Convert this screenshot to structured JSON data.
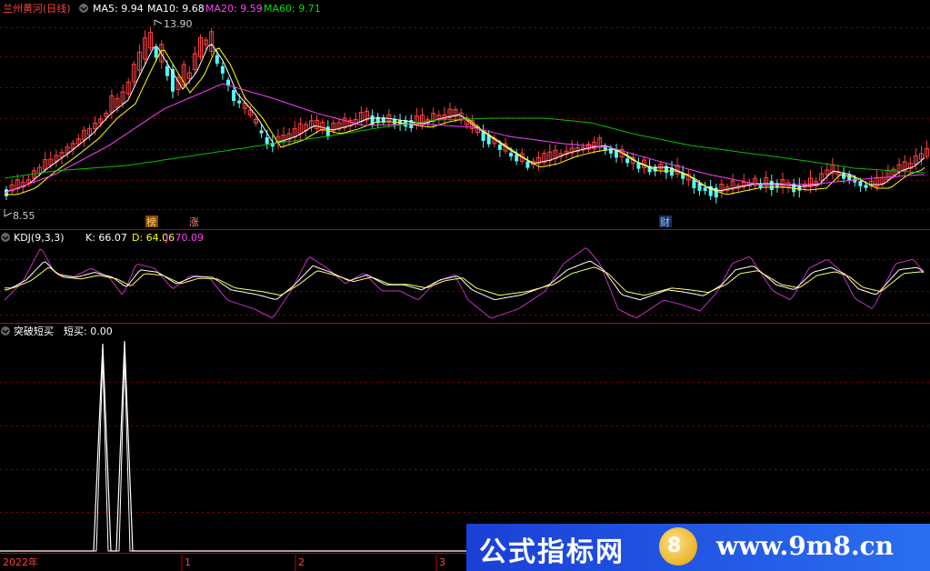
{
  "header": {
    "stock_title": "兰州黄河(日线)",
    "ma5": "MA5: 9.94",
    "ma10": "MA10: 9.68",
    "ma20": "MA20: 9.59",
    "ma60": "MA60: 9.71",
    "high_label": "13.90",
    "low_label": "8.55"
  },
  "markers": {
    "m1": "榜",
    "m2": "涨",
    "m3": "财"
  },
  "kdj": {
    "title": "KDJ(9,3,3)",
    "k": "K: 66.07",
    "d": "D: 64.06",
    "j": "J: 70.09"
  },
  "signal": {
    "title": "突破短买",
    "value": "短买: 0.00"
  },
  "axis": {
    "labels": [
      "2022年",
      "1",
      "2",
      "3"
    ]
  },
  "watermark": {
    "left": "公式指标网",
    "right": "www.9m8.cn",
    "logo": "8"
  },
  "colors": {
    "up": "#ff4040",
    "down": "#54ffff",
    "ma5": "#ffffff",
    "ma10": "#ffff00",
    "ma20": "#ff40ff",
    "ma60": "#00c000",
    "grid": "#8b0000",
    "panel_line": "#c00000"
  },
  "chart_data": [
    {
      "type": "candlestick",
      "title": "兰州黄河(日线)",
      "y_high": 13.9,
      "y_low": 8.55,
      "series": [
        {
          "name": "MA5",
          "last": 9.94
        },
        {
          "name": "MA10",
          "last": 9.68
        },
        {
          "name": "MA20",
          "last": 9.59
        },
        {
          "name": "MA60",
          "last": 9.71
        }
      ]
    },
    {
      "type": "line",
      "title": "KDJ(9,3,3)",
      "series": [
        {
          "name": "K",
          "last": 66.07
        },
        {
          "name": "D",
          "last": 64.06
        },
        {
          "name": "J",
          "last": 70.09
        }
      ]
    },
    {
      "type": "line",
      "title": "突破短买",
      "series": [
        {
          "name": "短买",
          "last": 0.0
        }
      ]
    }
  ]
}
